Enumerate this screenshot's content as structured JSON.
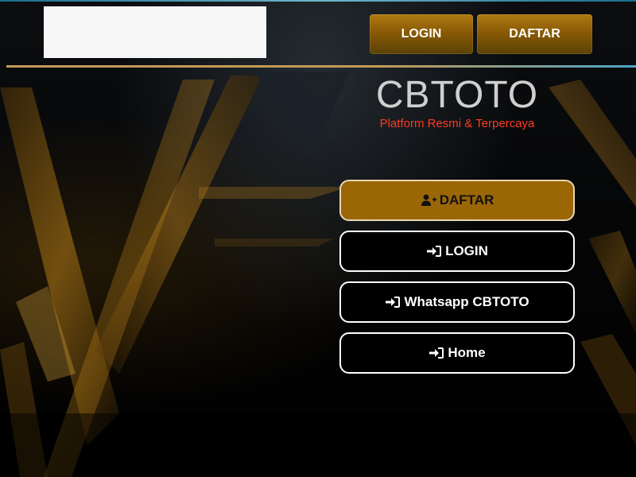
{
  "header": {
    "login_label": "LOGIN",
    "daftar_label": "DAFTAR"
  },
  "brand": {
    "name": "CBTOTO",
    "tagline": "Platform Resmi & Terpercaya"
  },
  "menu": [
    {
      "label": "DAFTAR",
      "icon": "user-plus-icon"
    },
    {
      "label": "LOGIN",
      "icon": "sign-in-icon"
    },
    {
      "label": "Whatsapp CBTOTO",
      "icon": "sign-in-icon"
    },
    {
      "label": "Home",
      "icon": "sign-in-icon"
    }
  ],
  "colors": {
    "accent_gold": "#9b6606",
    "tagline_red": "#ff3b1f",
    "brand_gray": "#cfcfcf"
  }
}
